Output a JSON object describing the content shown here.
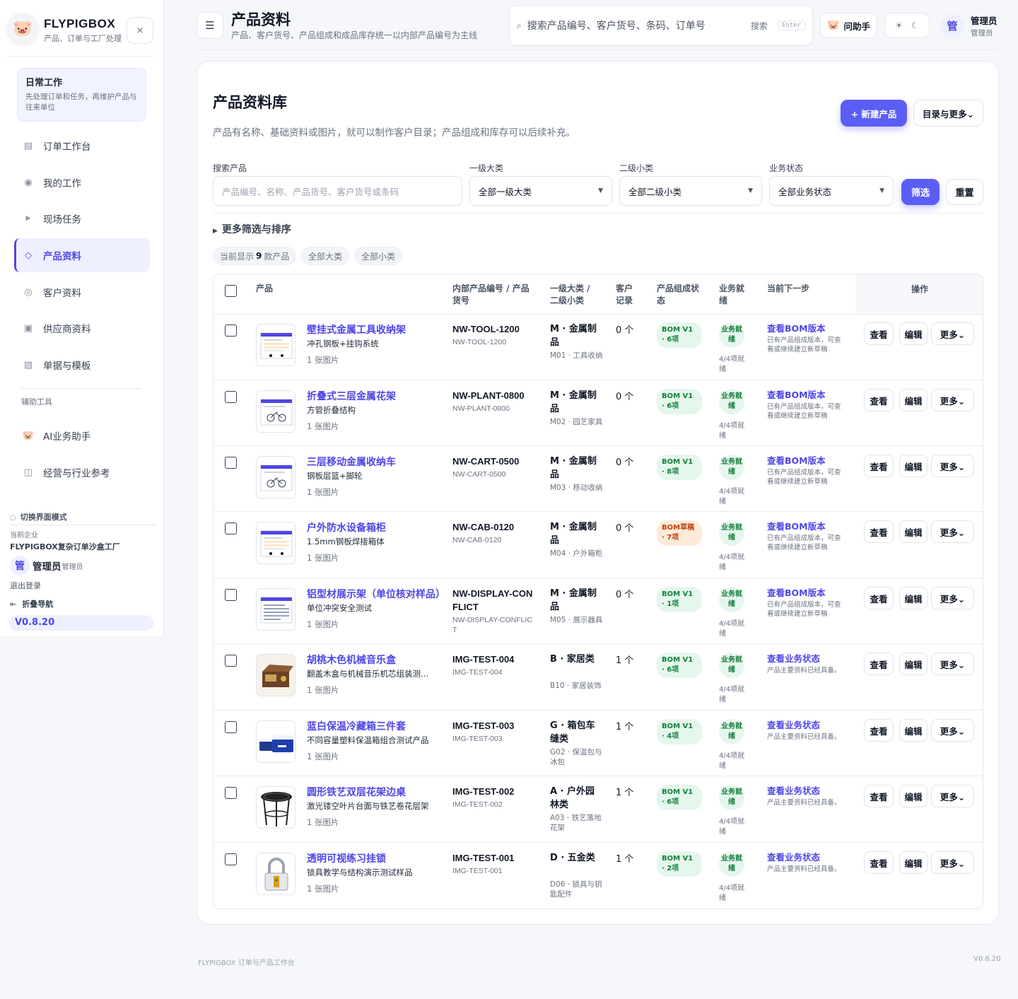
{
  "sidebar": {
    "brand_name": "FLYPIGBOX",
    "brand_sub": "产品、订单与工厂处理",
    "close_label": "×",
    "work_card": {
      "title": "日常工作",
      "desc": "先处理订单和任务，再维护产品与往来单位"
    },
    "items": [
      {
        "label": "订单工作台",
        "icon": "list-icon"
      },
      {
        "label": "我的工作",
        "icon": "target-icon"
      },
      {
        "label": "现场任务",
        "icon": "play-icon"
      },
      {
        "label": "产品资料",
        "icon": "diamond-icon",
        "active": true
      },
      {
        "label": "客户资料",
        "icon": "circle-icon"
      },
      {
        "label": "供应商资料",
        "icon": "square-dot-icon"
      },
      {
        "label": "单据与模板",
        "icon": "hatched-square-icon"
      }
    ],
    "tools_label": "辅助工具",
    "tools": [
      {
        "label": "AI业务助手",
        "icon": "pig-icon"
      },
      {
        "label": "经营与行业参考",
        "icon": "book-icon"
      }
    ],
    "mode_label": "切换界面模式",
    "enterprise_label": "当前企业",
    "enterprise_name": "FLYPIGBOX复杂订单沙盒工厂",
    "user_initial": "管",
    "user_name": "管理员",
    "user_role": "管理员",
    "logout_label": "退出登录",
    "collapse_label": "折叠导航",
    "version": "V0.8.20"
  },
  "header": {
    "menu_icon": "☰",
    "title": "产品资料",
    "subtitle": "产品、客户货号、产品组成和成品库存统一以内部产品编号为主线",
    "search_placeholder": "搜索产品编号、客户货号、条码、订单号",
    "search_label": "搜索",
    "search_key": "Enter",
    "helper_label": "问助手",
    "user_initial": "管",
    "user_name": "管理员",
    "user_role": "管理员"
  },
  "library": {
    "title": "产品资料库",
    "desc": "产品有名称、基础资料或图片，就可以制作客户目录；产品组成和库存可以后续补充。",
    "new_label": "+ 新建产品",
    "catalog_label": "目录与更多⌄",
    "filters": {
      "search_label": "搜索产品",
      "search_placeholder": "产品编号、名称、产品货号、客户货号或条码",
      "cat1_label": "一级大类",
      "cat1_value": "全部一级大类",
      "cat2_label": "二级小类",
      "cat2_value": "全部二级小类",
      "status_label": "业务状态",
      "status_value": "全部业务状态",
      "filter_btn": "筛选",
      "reset_btn": "重置"
    },
    "more_filters": "更多筛选与排序",
    "chips": {
      "count_prefix": "当前显示",
      "count": "9",
      "count_suffix": "款产品",
      "all_cat": "全部大类",
      "all_sub": "全部小类"
    }
  },
  "table": {
    "headers": {
      "product": "产品",
      "code": "内部产品编号 / 产品货号",
      "category": "一级大类 / 二级小类",
      "customer": "客户记录",
      "bom": "产品组成状态",
      "biz": "业务就绪",
      "next": "当前下一步",
      "ops": "操作"
    },
    "op_labels": {
      "view": "查看",
      "edit": "编辑",
      "more": "更多⌄"
    },
    "rows": [
      {
        "name": "壁挂式金属工具收纳架",
        "sub": "冲孔钢板+挂钩系统",
        "images": "1 张图片",
        "code": "NW-TOOL-1200",
        "code2": "NW-TOOL-1200",
        "cat": "M · 金属制品",
        "cat2": "M01 · 工具收纳",
        "cust": "0 个",
        "bom": "BOM V1 · 6项",
        "bom_type": "ok",
        "biz": "业务就绪",
        "biz_sub": "4/4项就绪",
        "next": "查看BOM版本",
        "next_sub": "已有产品组成版本，可查看或继续建立新草稿",
        "thumb": "doc"
      },
      {
        "name": "折叠式三层金属花架",
        "sub": "方管折叠结构",
        "images": "1 张图片",
        "code": "NW-PLANT-0800",
        "code2": "NW-PLANT-0800",
        "cat": "M · 金属制品",
        "cat2": "M02 · 园艺家具",
        "cust": "0 个",
        "bom": "BOM V1 · 6项",
        "bom_type": "ok",
        "biz": "业务就绪",
        "biz_sub": "4/4项就绪",
        "next": "查看BOM版本",
        "next_sub": "已有产品组成版本，可查看或继续建立新草稿",
        "thumb": "bike"
      },
      {
        "name": "三层移动金属收纳车",
        "sub": "钢板层篮+脚轮",
        "images": "1 张图片",
        "code": "NW-CART-0500",
        "code2": "NW-CART-0500",
        "cat": "M · 金属制品",
        "cat2": "M03 · 移动收纳",
        "cust": "0 个",
        "bom": "BOM V1 · 8项",
        "bom_type": "ok",
        "biz": "业务就绪",
        "biz_sub": "4/4项就绪",
        "next": "查看BOM版本",
        "next_sub": "已有产品组成版本，可查看或继续建立新草稿",
        "thumb": "bike"
      },
      {
        "name": "户外防水设备箱柜",
        "sub": "1.5mm钢板焊接箱体",
        "images": "1 张图片",
        "code": "NW-CAB-0120",
        "code2": "NW-CAB-0120",
        "cat": "M · 金属制品",
        "cat2": "M04 · 户外箱柜",
        "cust": "0 个",
        "bom": "BOM草稿 · 7项",
        "bom_type": "draft",
        "biz": "业务就绪",
        "biz_sub": "4/4项就绪",
        "next": "查看BOM版本",
        "next_sub": "已有产品组成版本，可查看或继续建立新草稿",
        "thumb": "doc"
      },
      {
        "name": "铝型材展示架（单位核对样品）",
        "sub": "单位冲突安全测试",
        "images": "1 张图片",
        "code": "NW-DISPLAY-CONFLICT",
        "code2": "NW-DISPLAY-CONFLICT",
        "cat": "M · 金属制品",
        "cat2": "M05 · 展示器具",
        "cust": "0 个",
        "bom": "BOM V1 · 1项",
        "bom_type": "ok",
        "biz": "业务就绪",
        "biz_sub": "4/4项就绪",
        "next": "查看BOM版本",
        "next_sub": "已有产品组成版本，可查看或继续建立新草稿",
        "thumb": "lines"
      },
      {
        "name": "胡桃木色机械音乐盒",
        "sub": "翻盖木盒与机械音乐机芯组装测试样品",
        "images": "1 张图片",
        "code": "IMG-TEST-004",
        "code2": "IMG-TEST-004",
        "cat": "B · 家居类",
        "cat2": "B10 · 家居装饰",
        "cust": "1 个",
        "bom": "BOM V1 · 6项",
        "bom_type": "ok",
        "biz": "业务就绪",
        "biz_sub": "4/4项就绪",
        "next": "查看业务状态",
        "next_sub": "产品主要资料已经具备。",
        "thumb": "box"
      },
      {
        "name": "蓝白保温冷藏箱三件套",
        "sub": "不同容量塑料保温箱组合测试产品",
        "images": "1 张图片",
        "code": "IMG-TEST-003",
        "code2": "IMG-TEST-003",
        "cat": "G · 箱包车缝类",
        "cat2": "G02 · 保温包与冰包",
        "cust": "1 个",
        "bom": "BOM V1 · 4项",
        "bom_type": "ok",
        "biz": "业务就绪",
        "biz_sub": "4/4项就绪",
        "next": "查看业务状态",
        "next_sub": "产品主要资料已经具备。",
        "thumb": "cooler"
      },
      {
        "name": "圆形铁艺双层花架边桌",
        "sub": "激光镂空叶片台面与铁艺卷花层架",
        "images": "1 张图片",
        "code": "IMG-TEST-002",
        "code2": "IMG-TEST-002",
        "cat": "A · 户外园林类",
        "cat2": "A03 · 铁艺落地花架",
        "cust": "1 个",
        "bom": "BOM V1 · 6项",
        "bom_type": "ok",
        "biz": "业务就绪",
        "biz_sub": "4/4项就绪",
        "next": "查看业务状态",
        "next_sub": "产品主要资料已经具备。",
        "thumb": "table"
      },
      {
        "name": "透明可视练习挂锁",
        "sub": "锁具教学与结构演示测试样品",
        "images": "1 张图片",
        "code": "IMG-TEST-001",
        "code2": "IMG-TEST-001",
        "cat": "D · 五金类",
        "cat2": "D06 · 锁具与钥匙配件",
        "cust": "1 个",
        "bom": "BOM V1 · 2项",
        "bom_type": "ok",
        "biz": "业务就绪",
        "biz_sub": "4/4项就绪",
        "next": "查看业务状态",
        "next_sub": "产品主要资料已经具备。",
        "thumb": "lock"
      }
    ]
  },
  "footer": {
    "left": "FLYPIGBOX 订单与产品工作台",
    "right": "V0.8.20"
  }
}
